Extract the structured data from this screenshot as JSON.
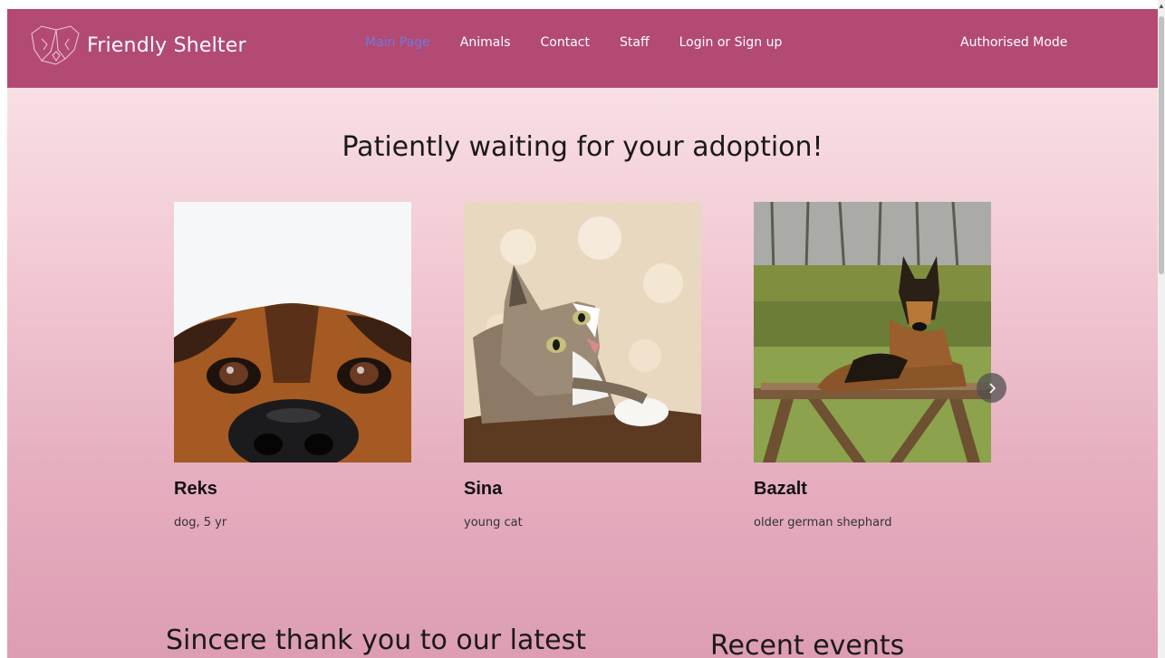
{
  "brand": {
    "name": "Friendly Shelter",
    "logo_icon": "dog-cat-logo-icon"
  },
  "nav": {
    "items": [
      {
        "label": "Main Page",
        "active": true
      },
      {
        "label": "Animals"
      },
      {
        "label": "Contact"
      },
      {
        "label": "Staff"
      },
      {
        "label": "Login or Sign up"
      }
    ],
    "auth_mode": "Authorised Mode"
  },
  "hero": {
    "title": "Patiently waiting for your adoption!"
  },
  "animals": [
    {
      "name": "Reks",
      "description": "dog, 5 yr"
    },
    {
      "name": "Sina",
      "description": "young cat"
    },
    {
      "name": "Bazalt",
      "description": "older german shephard"
    }
  ],
  "carousel": {
    "next_icon": "chevron-right-icon"
  },
  "sections": {
    "thanks_title": "Sincere thank you to our latest",
    "events_title": "Recent events"
  },
  "colors": {
    "navbar": "#b34a74",
    "active_link": "#6f79d8"
  }
}
